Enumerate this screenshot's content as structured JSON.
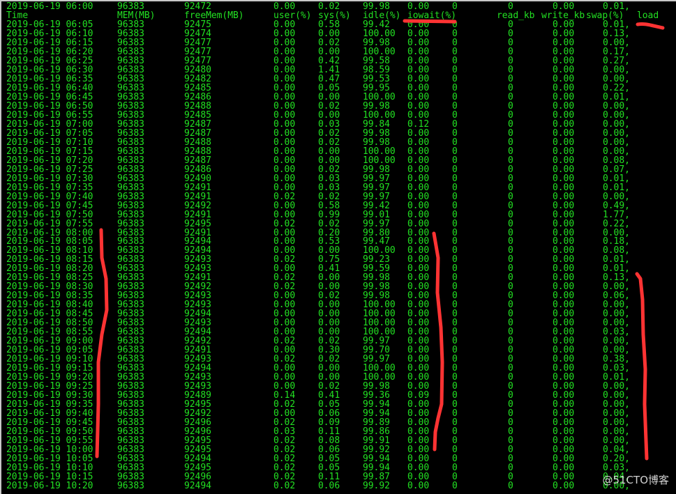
{
  "terminal": {
    "text_color": "#22e022",
    "background": "#000000",
    "first_row": [
      "2019-06-19 06:00",
      "96383",
      "92472",
      "0.00",
      "0.02",
      "99.98",
      "0.00",
      "0",
      "0",
      "0.00",
      "0.01,"
    ],
    "headers": [
      "Time",
      "MEM(MB)",
      "freeMem(MB)",
      "user(%)",
      "sys(%)",
      "idle(%)",
      "iowait(%)",
      "",
      "read_kb",
      "write_kb",
      "swap(%)",
      "load"
    ],
    "rows": [
      [
        "2019-06-19 06:05",
        "96383",
        "92475",
        "0.00",
        "0.58",
        "99.42",
        "0.00",
        "0",
        "0",
        "0.00",
        "0.01,"
      ],
      [
        "2019-06-19 06:10",
        "96383",
        "92474",
        "0.00",
        "0.00",
        "100.00",
        "0.00",
        "0",
        "0",
        "0.00",
        "0.13,"
      ],
      [
        "2019-06-19 06:15",
        "96383",
        "92477",
        "0.00",
        "0.02",
        "99.98",
        "0.00",
        "0",
        "0",
        "0.00",
        "0.00,"
      ],
      [
        "2019-06-19 06:20",
        "96383",
        "92477",
        "0.00",
        "0.00",
        "100.00",
        "0.00",
        "0",
        "0",
        "0.00",
        "0.17,"
      ],
      [
        "2019-06-19 06:25",
        "96383",
        "92477",
        "0.00",
        "0.42",
        "99.58",
        "0.00",
        "0",
        "0",
        "0.00",
        "0.27,"
      ],
      [
        "2019-06-19 06:30",
        "96383",
        "92480",
        "0.00",
        "1.41",
        "98.59",
        "0.00",
        "0",
        "0",
        "0.00",
        "0.00,"
      ],
      [
        "2019-06-19 06:35",
        "96383",
        "92482",
        "0.00",
        "0.47",
        "99.53",
        "0.00",
        "0",
        "0",
        "0.00",
        "0.00,"
      ],
      [
        "2019-06-19 06:40",
        "96383",
        "92485",
        "0.00",
        "0.05",
        "99.95",
        "0.00",
        "0",
        "0",
        "0.00",
        "0.22,"
      ],
      [
        "2019-06-19 06:45",
        "96383",
        "92486",
        "0.00",
        "0.00",
        "100.00",
        "0.00",
        "0",
        "0",
        "0.00",
        "0.01,"
      ],
      [
        "2019-06-19 06:50",
        "96383",
        "92488",
        "0.00",
        "0.02",
        "99.98",
        "0.00",
        "0",
        "0",
        "0.00",
        "0.00,"
      ],
      [
        "2019-06-19 06:55",
        "96383",
        "92485",
        "0.00",
        "0.00",
        "100.00",
        "0.00",
        "0",
        "0",
        "0.00",
        "0.00,"
      ],
      [
        "2019-06-19 07:00",
        "96383",
        "92487",
        "0.00",
        "0.03",
        "99.84",
        "0.12",
        "0",
        "0",
        "0.00",
        "0.00,"
      ],
      [
        "2019-06-19 07:05",
        "96383",
        "92487",
        "0.00",
        "0.02",
        "99.98",
        "0.00",
        "0",
        "0",
        "0.00",
        "0.00,"
      ],
      [
        "2019-06-19 07:10",
        "96383",
        "92488",
        "0.00",
        "0.02",
        "99.98",
        "0.00",
        "0",
        "0",
        "0.00",
        "0.00,"
      ],
      [
        "2019-06-19 07:15",
        "96383",
        "92488",
        "0.00",
        "0.00",
        "100.00",
        "0.00",
        "0",
        "0",
        "0.00",
        "0.00,"
      ],
      [
        "2019-06-19 07:20",
        "96383",
        "92487",
        "0.00",
        "0.00",
        "100.00",
        "0.00",
        "0",
        "0",
        "0.00",
        "0.08,"
      ],
      [
        "2019-06-19 07:25",
        "96383",
        "92486",
        "0.00",
        "0.02",
        "99.98",
        "0.00",
        "0",
        "0",
        "0.00",
        "0.07,"
      ],
      [
        "2019-06-19 07:30",
        "96383",
        "92490",
        "0.00",
        "0.03",
        "99.97",
        "0.00",
        "0",
        "0",
        "0.00",
        "0.01,"
      ],
      [
        "2019-06-19 07:35",
        "96383",
        "92491",
        "0.00",
        "0.03",
        "99.97",
        "0.00",
        "0",
        "0",
        "0.00",
        "0.01,"
      ],
      [
        "2019-06-19 07:40",
        "96383",
        "92491",
        "0.02",
        "0.02",
        "99.97",
        "0.00",
        "0",
        "0",
        "0.00",
        "0.00,"
      ],
      [
        "2019-06-19 07:45",
        "96383",
        "92492",
        "0.00",
        "0.58",
        "99.42",
        "0.00",
        "0",
        "0",
        "0.00",
        "0.49,"
      ],
      [
        "2019-06-19 07:50",
        "96383",
        "92491",
        "0.00",
        "0.99",
        "99.01",
        "0.00",
        "0",
        "0",
        "0.00",
        "1.77,"
      ],
      [
        "2019-06-19 07:55",
        "96383",
        "92495",
        "0.02",
        "0.02",
        "99.97",
        "0.00",
        "0",
        "0",
        "0.00",
        "0.22,"
      ],
      [
        "2019-06-19 08:00",
        "96383",
        "92491",
        "0.00",
        "0.20",
        "99.80",
        "0.00",
        "0",
        "0",
        "0.00",
        "0.00,"
      ],
      [
        "2019-06-19 08:05",
        "96383",
        "92494",
        "0.00",
        "0.53",
        "99.47",
        "0.00",
        "0",
        "0",
        "0.00",
        "0.18,"
      ],
      [
        "2019-06-19 08:10",
        "96383",
        "92494",
        "0.00",
        "0.00",
        "100.00",
        "0.00",
        "0",
        "0",
        "0.00",
        "0.08,"
      ],
      [
        "2019-06-19 08:15",
        "96383",
        "92493",
        "0.02",
        "0.75",
        "99.23",
        "0.00",
        "0",
        "0",
        "0.00",
        "0.01,"
      ],
      [
        "2019-06-19 08:20",
        "96383",
        "92493",
        "0.00",
        "0.41",
        "99.59",
        "0.00",
        "0",
        "0",
        "0.00",
        "0.01,"
      ],
      [
        "2019-06-19 08:25",
        "96383",
        "92491",
        "0.02",
        "0.00",
        "99.98",
        "0.00",
        "0",
        "0",
        "0.00",
        "0.13,"
      ],
      [
        "2019-06-19 08:30",
        "96383",
        "92492",
        "0.02",
        "0.00",
        "99.98",
        "0.00",
        "0",
        "0",
        "0.00",
        "0.00,"
      ],
      [
        "2019-06-19 08:35",
        "96383",
        "92493",
        "0.00",
        "0.02",
        "99.98",
        "0.00",
        "0",
        "0",
        "0.00",
        "0.06,"
      ],
      [
        "2019-06-19 08:40",
        "96383",
        "92493",
        "0.00",
        "0.00",
        "100.00",
        "0.00",
        "0",
        "0",
        "0.00",
        "0.00,"
      ],
      [
        "2019-06-19 08:45",
        "96383",
        "92494",
        "0.00",
        "0.00",
        "100.00",
        "0.00",
        "0",
        "0",
        "0.00",
        "0.00,"
      ],
      [
        "2019-06-19 08:50",
        "96383",
        "92493",
        "0.00",
        "0.00",
        "100.00",
        "0.00",
        "0",
        "0",
        "0.00",
        "0.00,"
      ],
      [
        "2019-06-19 08:55",
        "96383",
        "92494",
        "0.00",
        "0.00",
        "100.00",
        "0.00",
        "0",
        "0",
        "0.00",
        "0.03,"
      ],
      [
        "2019-06-19 09:00",
        "96383",
        "92492",
        "0.02",
        "0.02",
        "99.97",
        "0.00",
        "0",
        "0",
        "0.00",
        "0.00,"
      ],
      [
        "2019-06-19 09:05",
        "96383",
        "92491",
        "0.00",
        "0.30",
        "99.70",
        "0.00",
        "0",
        "0",
        "0.00",
        "0.00,"
      ],
      [
        "2019-06-19 09:10",
        "96383",
        "92493",
        "0.02",
        "0.02",
        "99.97",
        "0.00",
        "0",
        "0",
        "0.00",
        "0.38,"
      ],
      [
        "2019-06-19 09:15",
        "96383",
        "92494",
        "0.00",
        "0.00",
        "100.00",
        "0.00",
        "0",
        "0",
        "0.00",
        "0.03,"
      ],
      [
        "2019-06-19 09:20",
        "96383",
        "92493",
        "0.00",
        "0.00",
        "100.00",
        "0.00",
        "0",
        "0",
        "0.00",
        "0.01,"
      ],
      [
        "2019-06-19 09:25",
        "96383",
        "92493",
        "0.00",
        "0.02",
        "99.98",
        "0.00",
        "0",
        "0",
        "0.00",
        "0.00,"
      ],
      [
        "2019-06-19 09:30",
        "96383",
        "92489",
        "0.14",
        "0.41",
        "99.36",
        "0.09",
        "0",
        "0",
        "0.00",
        "0.00,"
      ],
      [
        "2019-06-19 09:35",
        "96383",
        "92495",
        "0.02",
        "0.05",
        "99.94",
        "0.00",
        "0",
        "0",
        "0.00",
        "0.00,"
      ],
      [
        "2019-06-19 09:40",
        "96383",
        "92492",
        "0.00",
        "0.06",
        "99.94",
        "0.00",
        "0",
        "0",
        "0.00",
        "0.00,"
      ],
      [
        "2019-06-19 09:45",
        "96383",
        "92496",
        "0.02",
        "0.09",
        "99.89",
        "0.00",
        "0",
        "0",
        "0.00",
        "0.00,"
      ],
      [
        "2019-06-19 09:50",
        "96383",
        "92496",
        "0.03",
        "0.11",
        "99.86",
        "0.00",
        "0",
        "0",
        "0.00",
        "0.00,"
      ],
      [
        "2019-06-19 09:55",
        "96383",
        "92495",
        "0.02",
        "0.08",
        "99.91",
        "0.00",
        "0",
        "0",
        "0.00",
        "0.00,"
      ],
      [
        "2019-06-19 10:00",
        "96383",
        "92495",
        "0.02",
        "0.06",
        "99.92",
        "0.00",
        "0",
        "0",
        "0.00",
        "0.04,"
      ],
      [
        "2019-06-19 10:05",
        "96383",
        "92494",
        "0.02",
        "0.05",
        "99.94",
        "0.00",
        "0",
        "0",
        "0.00",
        "0.20,"
      ],
      [
        "2019-06-19 10:10",
        "96383",
        "92495",
        "0.02",
        "0.05",
        "99.94",
        "0.00",
        "0",
        "0",
        "0.00",
        "0.03,"
      ],
      [
        "2019-06-19 10:15",
        "96383",
        "92496",
        "0.02",
        "0.11",
        "99.87",
        "0.00",
        "0",
        "0",
        "0.00",
        "0.04,"
      ],
      [
        "2019-06-19 10:20",
        "96383",
        "92494",
        "0.02",
        "0.06",
        "99.92",
        "0.00",
        "0",
        "0",
        "0.00",
        "0.00,"
      ]
    ]
  },
  "annotations": {
    "color": "#ff3333",
    "marks": [
      "underline-iowait",
      "underline-load",
      "bracket-time",
      "bracket-iowait",
      "bracket-load"
    ]
  },
  "watermark": "@51CTO博客"
}
